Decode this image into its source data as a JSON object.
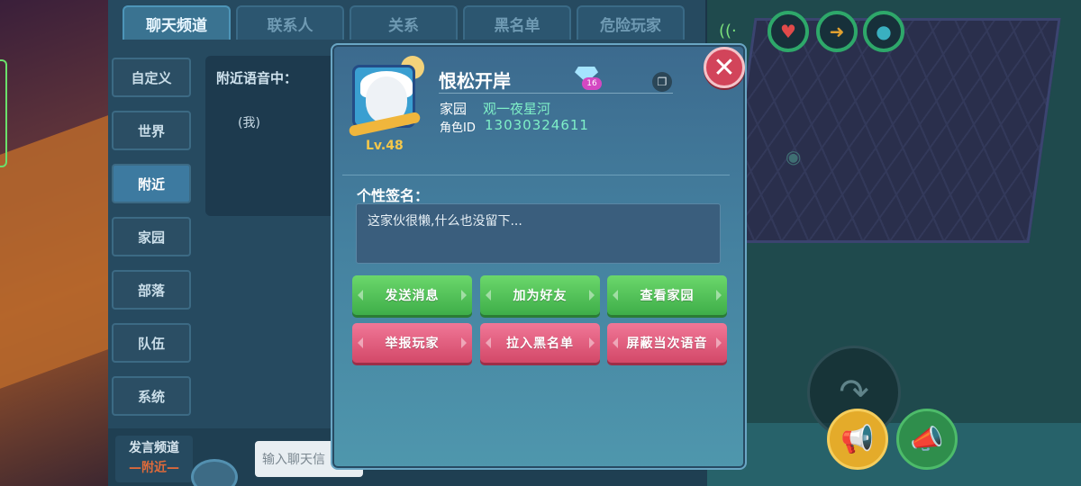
{
  "tabs": [
    {
      "label": "聊天频道"
    },
    {
      "label": "联系人"
    },
    {
      "label": "关系"
    },
    {
      "label": "黑名单"
    },
    {
      "label": "危险玩家"
    }
  ],
  "sidebar": {
    "items": [
      {
        "label": "自定义"
      },
      {
        "label": "世界"
      },
      {
        "label": "附近"
      },
      {
        "label": "家园"
      },
      {
        "label": "部落"
      },
      {
        "label": "队伍"
      },
      {
        "label": "系统"
      }
    ]
  },
  "nearby": {
    "title": "附近语音中：",
    "me": "(我)"
  },
  "speak_channel": {
    "title": "发言频道",
    "value": "—附近—"
  },
  "chat_input": {
    "placeholder": "输入聊天信"
  },
  "profile": {
    "level": "Lv.48",
    "name": "恨松开岸",
    "badge_number": "16",
    "home_label": "家园",
    "home_value": "观一夜星河",
    "id_label": "角色ID",
    "id_value": "13030324611",
    "signature_label": "个性签名：",
    "signature_text": "这家伙很懒,什么也没留下..."
  },
  "actions": {
    "send_message": "发送消息",
    "add_friend": "加为好友",
    "view_home": "查看家园",
    "report_player": "举报玩家",
    "blacklist": "拉入黑名单",
    "mute_voice": "屏蔽当次语音"
  },
  "icons": {
    "close": "close-icon",
    "copy": "copy-icon",
    "heart": "heart-icon",
    "megaphone": "megaphone-icon"
  },
  "colors": {
    "dialog_top": "#3c6a8e",
    "accent_green": "#3fae49",
    "accent_red": "#d34868",
    "id_cyan": "#7ff0c8",
    "level_gold": "#f5c74a"
  }
}
